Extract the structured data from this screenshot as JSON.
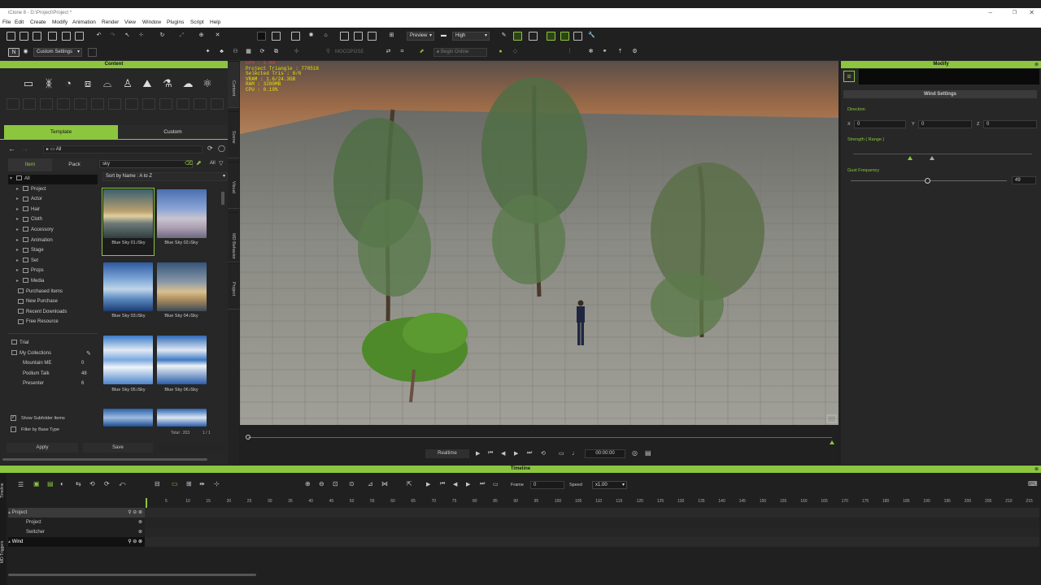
{
  "window": {
    "title": "iClone 8 - D:\\Project\\Project *"
  },
  "menu": [
    "File",
    "Edit",
    "Create",
    "Modify",
    "Animation",
    "Render",
    "View",
    "Window",
    "Plugins",
    "Script",
    "Help"
  ],
  "toolbar": {
    "preview_label": "Preview",
    "quality_label": "High",
    "settings_label": "Custom Settings",
    "motion_label": "MOCOPOSE",
    "search_placeholder": "Begin Online"
  },
  "content_panel": {
    "title": "Content",
    "tab_template": "Template",
    "tab_custom": "Custom",
    "path_label": "All",
    "item_tab": "Item",
    "pack_tab": "Pack",
    "search_value": "sky",
    "all_label": "All",
    "sort_label": "Sort by Name : A to Z",
    "tree": [
      {
        "label": "All",
        "icon": "folder-icon"
      },
      {
        "label": "Project",
        "icon": "folder-icon"
      },
      {
        "label": "Actor",
        "icon": "actor-icon"
      },
      {
        "label": "Hair",
        "icon": "hair-icon"
      },
      {
        "label": "Cloth",
        "icon": "cloth-icon"
      },
      {
        "label": "Accessory",
        "icon": "accessory-icon"
      },
      {
        "label": "Animation",
        "icon": "animation-icon"
      },
      {
        "label": "Stage",
        "icon": "stage-icon"
      },
      {
        "label": "Set",
        "icon": "set-icon"
      },
      {
        "label": "Props",
        "icon": "props-icon"
      },
      {
        "label": "Media",
        "icon": "media-icon"
      },
      {
        "label": "Purchased Items",
        "icon": "cart-icon"
      },
      {
        "label": "New Purchase",
        "icon": "cart-icon"
      },
      {
        "label": "Recent Downloads",
        "icon": "download-icon"
      },
      {
        "label": "Free Resource",
        "icon": "gift-icon"
      }
    ],
    "tree2": [
      {
        "label": "Trial",
        "count": ""
      },
      {
        "label": "My Collections",
        "count": ""
      },
      {
        "label": "Mountain ME",
        "count": "0"
      },
      {
        "label": "Podium Talk",
        "count": "48"
      },
      {
        "label": "Presenter",
        "count": "6"
      }
    ],
    "thumbs": [
      "Blue Sky 01.iSky",
      "Blue Sky 02.iSky",
      "Blue Sky 03.iSky",
      "Blue Sky 04.iSky",
      "Blue Sky 05.iSky",
      "Blue Sky 06.iSky"
    ],
    "show_subfolder": "Show Subfolder Items",
    "filter_base": "Filter by Base Type",
    "total_label": "Total : 203",
    "page_label": "1 / 1",
    "apply_label": "Apply",
    "save_label": "Save"
  },
  "side_tabs": [
    "Content",
    "Scene",
    "Visual",
    "MD Behavior",
    "Project"
  ],
  "viewport": {
    "stats": [
      "FPS : 1.00",
      "Project Triangle : 770518",
      "Selected Tris : 0/0",
      "VRAM : 1.6/24.3GB",
      "RAM : 3280MB",
      "CPU : 0.19%"
    ]
  },
  "playback": {
    "realtime_label": "Realtime",
    "time_value": "00:00:00"
  },
  "modify_panel": {
    "title": "Modify",
    "section_title": "Wind Settings",
    "direction_label": "Direction",
    "x_label": "X",
    "x_value": "0",
    "y_label": "Y",
    "y_value": "0",
    "z_label": "Z",
    "z_value": "0",
    "strength_label": "Strength ( Range )",
    "gust_label": "Gust Frequency",
    "gust_value": "49",
    "gust_fraction": 0.49
  },
  "timeline": {
    "title": "Timeline",
    "frame_label": "Frame",
    "frame_value": "0",
    "speed_label": "Speed",
    "speed_value": "x1.00",
    "ticks": [
      "5",
      "10",
      "15",
      "20",
      "25",
      "30",
      "35",
      "40",
      "45",
      "50",
      "55",
      "60",
      "65",
      "70",
      "75",
      "80",
      "85",
      "90",
      "95",
      "100",
      "105",
      "110",
      "115",
      "120",
      "125",
      "130",
      "135",
      "140",
      "145",
      "150",
      "155",
      "160",
      "165",
      "170",
      "175",
      "180",
      "185",
      "190",
      "195",
      "200",
      "205",
      "210",
      "215"
    ],
    "tracks": [
      {
        "label": "Project",
        "level": 0,
        "style": "header"
      },
      {
        "label": "Project",
        "level": 1,
        "style": "child"
      },
      {
        "label": "Switcher",
        "level": 1,
        "style": "child"
      },
      {
        "label": "Wind",
        "level": 0,
        "style": "selected"
      }
    ],
    "side_tabs": [
      "Timeline",
      "MD Triggers"
    ]
  },
  "colors": {
    "accent": "#8cc63f",
    "stats_text": "#e8e000",
    "fps_text": "#ff3a3a"
  }
}
